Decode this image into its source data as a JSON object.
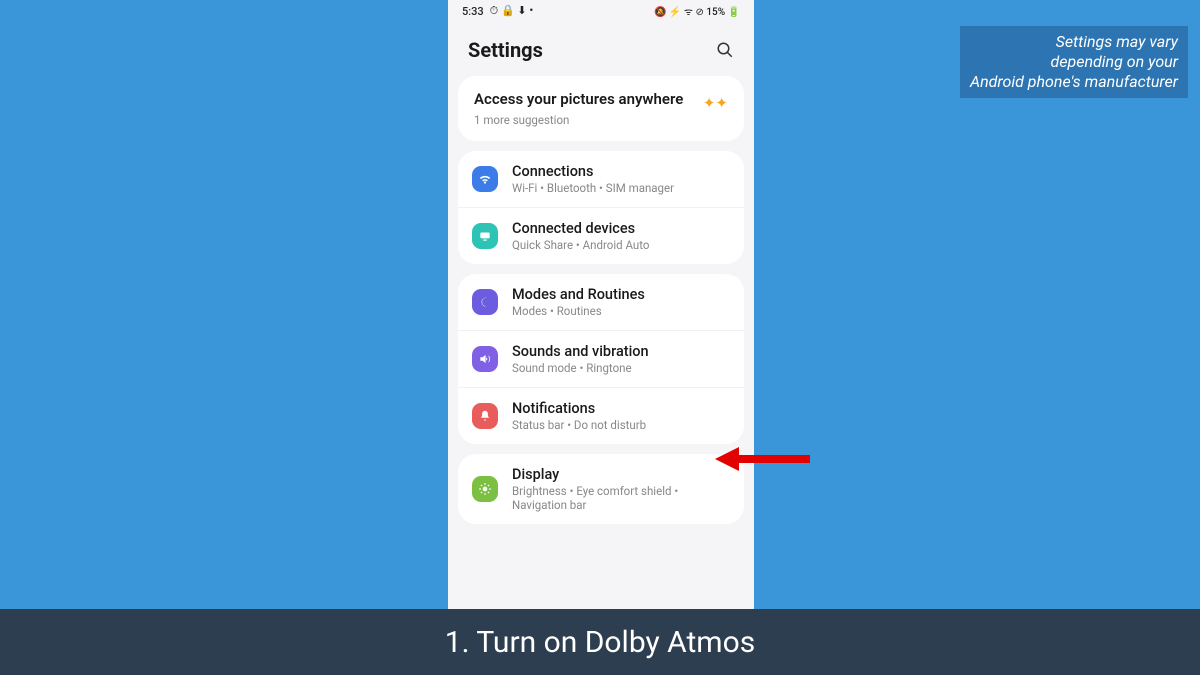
{
  "statusbar": {
    "time": "5:33",
    "left_icons": "⏱ 🔒 ⬇ •",
    "right_icons": "🔕 ⚡ ᯤ ⊘ 15% 🔋"
  },
  "header": {
    "title": "Settings",
    "search_icon": "search"
  },
  "suggestion": {
    "title": "Access your pictures anywhere",
    "subtitle": "1 more suggestion",
    "sparkle": "✦✦"
  },
  "groups": [
    {
      "items": [
        {
          "icon": "wifi",
          "color": "ic-blue",
          "title": "Connections",
          "sub": "Wi-Fi • Bluetooth • SIM manager"
        },
        {
          "icon": "share",
          "color": "ic-teal",
          "title": "Connected devices",
          "sub": "Quick Share • Android Auto"
        }
      ]
    },
    {
      "items": [
        {
          "icon": "moon",
          "color": "ic-purple",
          "title": "Modes and Routines",
          "sub": "Modes • Routines"
        },
        {
          "icon": "sound",
          "color": "ic-violet",
          "title": "Sounds and vibration",
          "sub": "Sound mode • Ringtone"
        },
        {
          "icon": "bell",
          "color": "ic-red",
          "title": "Notifications",
          "sub": "Status bar • Do not disturb"
        }
      ]
    },
    {
      "items": [
        {
          "icon": "sun",
          "color": "ic-green",
          "title": "Display",
          "sub": "Brightness • Eye comfort shield • Navigation bar"
        }
      ]
    }
  ],
  "caption": "1. Turn on Dolby Atmos",
  "note": {
    "line1": "Settings may vary",
    "line2": "depending on your",
    "line3": "Android phone's manufacturer"
  }
}
